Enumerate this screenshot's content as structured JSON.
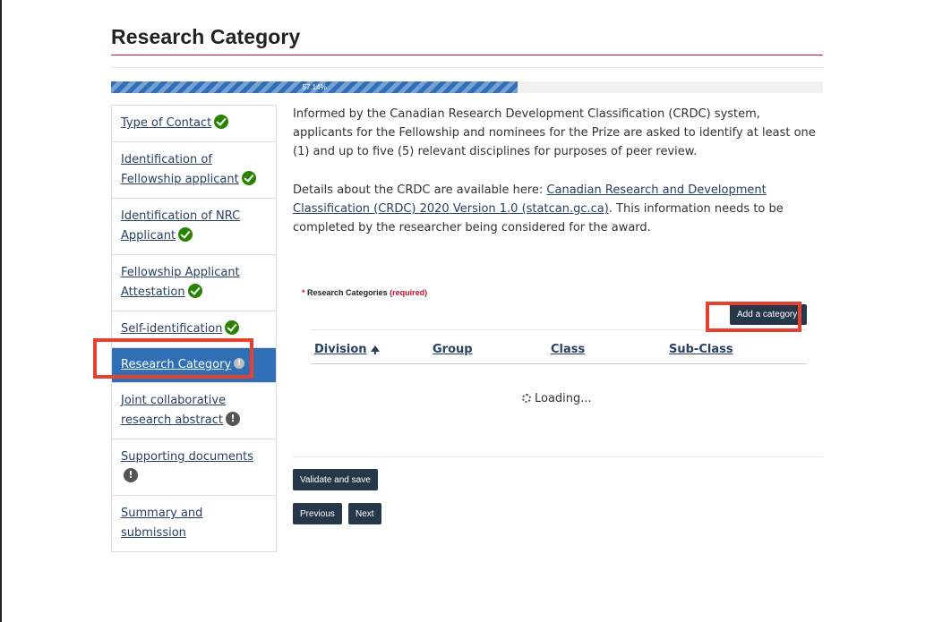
{
  "page": {
    "title": "Research Category"
  },
  "progress": {
    "label": "57.14%",
    "percent": 57.14
  },
  "sidebar": {
    "items": [
      {
        "label": "Type of Contact",
        "status": "complete",
        "icon": "check-icon"
      },
      {
        "label": "Identification of Fellowship applicant",
        "status": "complete",
        "icon": "check-icon"
      },
      {
        "label": "Identification of NRC Applicant",
        "status": "complete",
        "icon": "check-icon"
      },
      {
        "label": "Fellowship Applicant Attestation",
        "status": "complete",
        "icon": "check-icon"
      },
      {
        "label": "Self-identification",
        "status": "complete",
        "icon": "check-icon"
      },
      {
        "label": "Research Category",
        "status": "incomplete",
        "icon": "exclamation-icon",
        "active": true
      },
      {
        "label": "Joint collaborative research abstract",
        "status": "incomplete",
        "icon": "exclamation-icon"
      },
      {
        "label": "Supporting documents",
        "status": "incomplete",
        "icon": "exclamation-icon"
      },
      {
        "label": "Summary and submission",
        "status": "none"
      }
    ]
  },
  "intro": {
    "paragraph1": "Informed by the Canadian Research Development Classification (CRDC) system, applicants for the Fellowship and nominees for the Prize are asked to identify at least one (1) and up to five (5) relevant disciplines for purposes of peer review.",
    "paragraph2_before": "Details about the CRDC are available here: ",
    "paragraph2_link": "Canadian Research and Development Classification (CRDC) 2020 Version 1.0 (statcan.gc.ca)",
    "paragraph2_after": ". This information needs to be completed by the researcher being considered for the award."
  },
  "categories": {
    "star": "*",
    "label": "Research Categories",
    "required": "(required)",
    "add_button": "Add a category",
    "columns": [
      "Division",
      "Group",
      "Class",
      "Sub-Class"
    ],
    "loading": "Loading..."
  },
  "actions": {
    "validate": "Validate and save",
    "previous": "Previous",
    "next": "Next"
  },
  "colors": {
    "accent": "#2e6fb5",
    "rule": "#c8102e",
    "button": "#26374a",
    "highlight": "#e8402f",
    "complete": "#278400"
  }
}
